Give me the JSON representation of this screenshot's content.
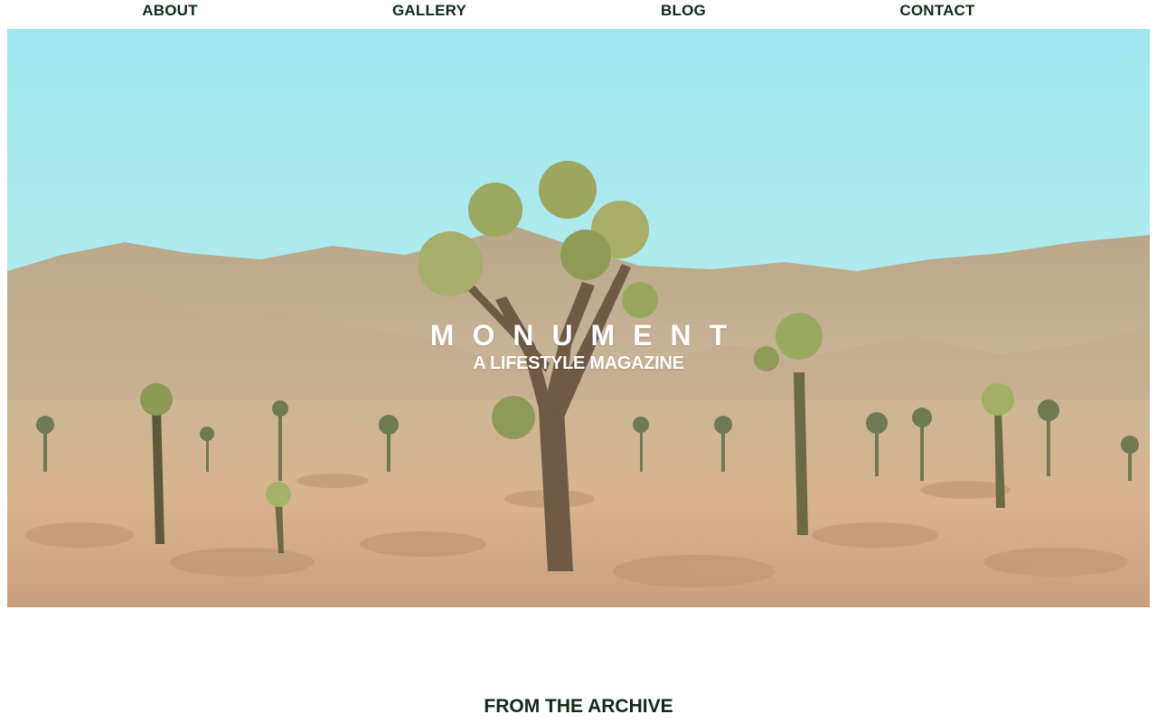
{
  "nav": {
    "items": [
      {
        "label": "ABOUT"
      },
      {
        "label": "GALLERY"
      },
      {
        "label": "BLOG"
      },
      {
        "label": "CONTACT"
      }
    ]
  },
  "hero": {
    "title": "MONUMENT",
    "subtitle": "A LIFESTYLE MAGAZINE",
    "image": "desert-joshua-tree-photo"
  },
  "archive": {
    "heading": "FROM THE ARCHIVE"
  },
  "colors": {
    "nav_text": "#0f2a17",
    "hero_text": "#ffffff",
    "sky": "#a9eaf0",
    "sand": "#d9b48f"
  }
}
